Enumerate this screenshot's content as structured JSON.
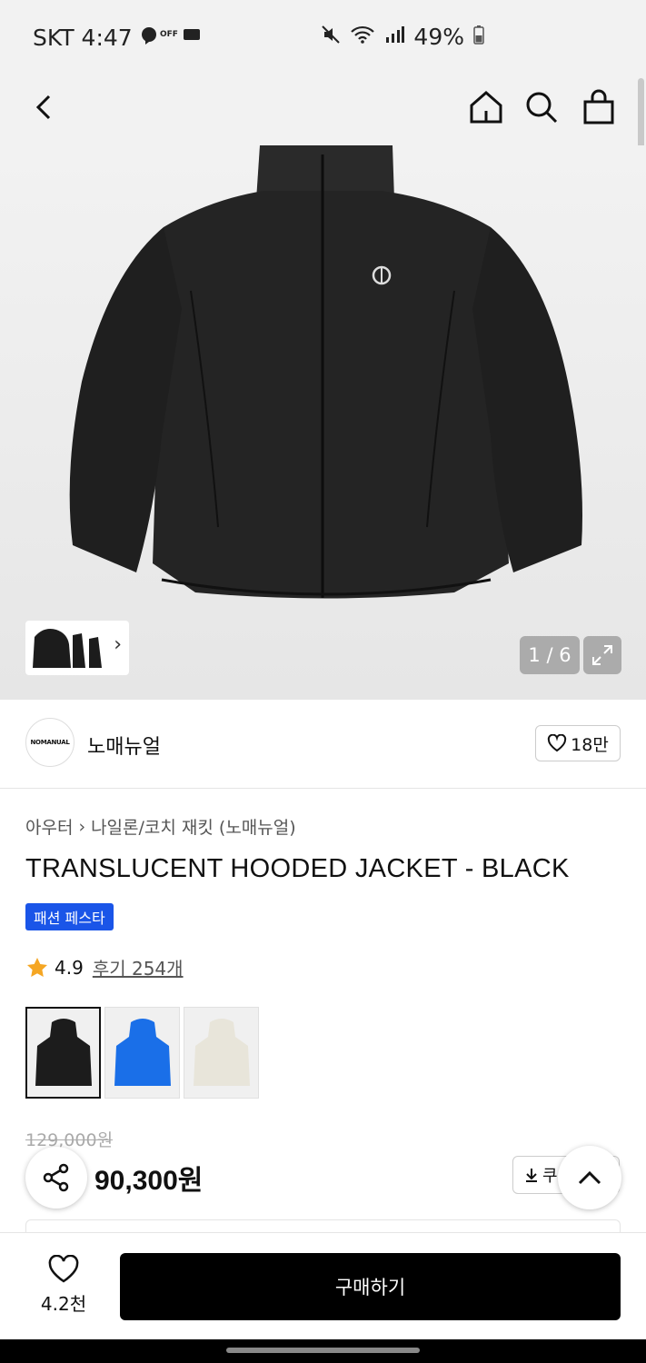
{
  "status_bar": {
    "carrier_time": "SKT 4:47",
    "battery": "49%"
  },
  "nav": {
    "back_icon": "chevron-left-icon",
    "home_icon": "home-icon",
    "search_icon": "search-icon",
    "cart_icon": "shopping-bag-icon"
  },
  "gallery": {
    "counter": "1 / 6",
    "expand_icon": "expand-icon"
  },
  "brand": {
    "logo_text": "NOMANUAL",
    "name": "노매뉴얼",
    "likes": "18만"
  },
  "product": {
    "breadcrumb": [
      "아우터",
      "나일론/코치 재킷 (노매뉴얼)"
    ],
    "title": "TRANSLUCENT HOODED JACKET - BLACK",
    "badge": "패션 페스타",
    "rating": "4.9",
    "reviews": "후기 254개",
    "color_options": [
      {
        "color": "#1c1c1c",
        "selected": true
      },
      {
        "color": "#1a6fe8",
        "selected": false
      },
      {
        "color": "#ece9df",
        "selected": false
      }
    ],
    "original_price": "129,000원",
    "price": "90,300원",
    "coupon_label": "쿠"
  },
  "bottom_bar": {
    "wishlist_count": "4.2천",
    "buy_label": "구매하기"
  }
}
